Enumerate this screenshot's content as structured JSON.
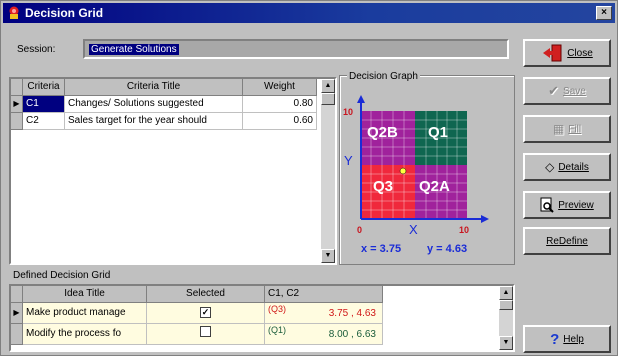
{
  "window": {
    "title": "Decision Grid",
    "close_glyph": "×",
    "icon": "app-decision-icon"
  },
  "session": {
    "label": "Session:",
    "value": "Generate Solutions"
  },
  "criteria_grid": {
    "headers": [
      "Criteria",
      "Criteria Title",
      "Weight"
    ],
    "rows": [
      {
        "indicator": "▶",
        "criteria": "C1",
        "title": "Changes/ Solutions suggested",
        "weight": "0.80",
        "selected": true
      },
      {
        "indicator": "",
        "criteria": "C2",
        "title": "Sales target for the year should",
        "weight": "0.60",
        "selected": false
      }
    ]
  },
  "graph": {
    "title": "Decision Graph",
    "y_axis_label": "Y",
    "x_axis_label": "X",
    "y_tick_max": "10",
    "x_tick_min": "0",
    "x_tick_max": "10",
    "quadrants": {
      "q2b": "Q2B",
      "q1": "Q1",
      "q3": "Q3",
      "q2a": "Q2A"
    },
    "readout_x": "x = 3.75",
    "readout_y": "y = 4.63",
    "colors": {
      "q2b": "#a0229c",
      "q1": "#0f6650",
      "q3": "#f0283c",
      "q2a": "#a0229c",
      "axis": "#1a2cd6",
      "label": "#c8141e"
    }
  },
  "buttons": {
    "close": "Close",
    "save": "Save",
    "fill": "Fill",
    "details": "Details",
    "preview": "Preview",
    "redefine": "ReDefine",
    "help": "Help"
  },
  "defined_grid": {
    "label": "Defined Decision Grid",
    "headers": [
      "Idea Title",
      "Selected",
      "C1, C2"
    ],
    "rows": [
      {
        "indicator": "▶",
        "title": "Make product manage",
        "checked": "✓",
        "quadrant": "(Q3)",
        "value": "3.75 , 4.63",
        "value_color": "#d01818"
      },
      {
        "indicator": "",
        "title": "Modify the process fo",
        "checked": "",
        "quadrant": "(Q1)",
        "value": "8.00 , 6.63",
        "value_color": "#1a5c3a"
      }
    ]
  }
}
